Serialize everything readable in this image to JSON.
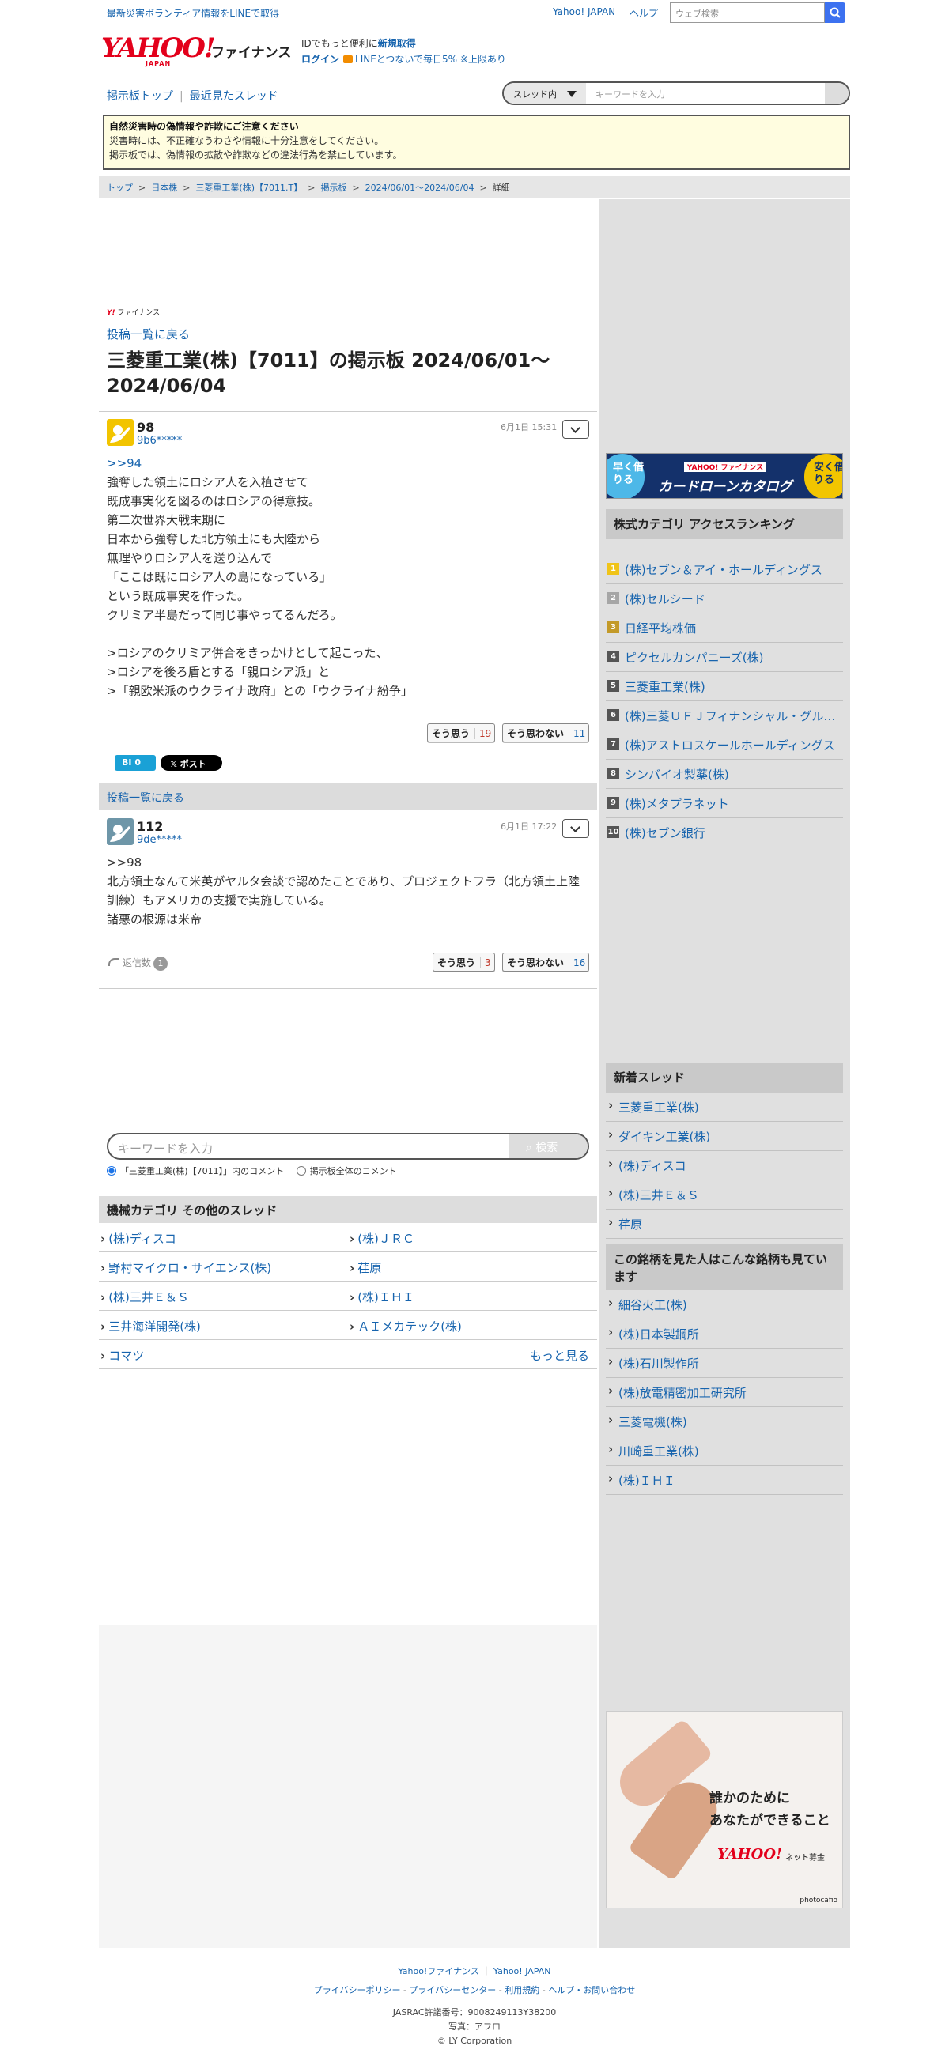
{
  "topbar": {
    "disaster_link": "最新災害ボランティア情報をLINEで取得",
    "yahoo_japan": "Yahoo! JAPAN",
    "help": "ヘルプ",
    "web_search_placeholder": "ウェブ検索"
  },
  "header": {
    "logo_text": "YAHOO!",
    "logo_sub": "JAPAN",
    "service": "ファイナンス",
    "id_prefix": "IDでもっと便利に",
    "id_register": "新規取得",
    "login": "ログイン",
    "line_promo": "LINEとつないで毎日5% ※上限あり"
  },
  "nav": {
    "board_top": "掲示板トップ",
    "recent_threads": "最近見たスレッド",
    "scope": "スレッド内",
    "search_placeholder": "キーワードを入力"
  },
  "notice": {
    "title": "自然災害時の偽情報や詐欺にご注意ください",
    "line1": "災害時には、不正確なうわさや情報に十分注意をしてください。",
    "line2": "掲示板では、偽情報の拡散や詐欺などの違法行為を禁止しています。"
  },
  "breadcrumb": [
    "トップ",
    "日本株",
    "三菱重工業(株)【7011.T】",
    "掲示板",
    "2024/06/01〜2024/06/04",
    "詳細"
  ],
  "main": {
    "small_logo": "ファイナンス",
    "back_link": "投稿一覧に戻る",
    "title": "三菱重工業(株)【7011】の掲示板 2024/06/01〜2024/06/04"
  },
  "posts": [
    {
      "num": "98",
      "user": "9b6*****",
      "date": "6月1日 15:31",
      "reply_link": ">>94",
      "lines": [
        "強奪した領土にロシア人を入植させて",
        "既成事実化を図るのはロシアの得意技。",
        "第二次世界大戦末期に",
        "日本から強奪した北方領土にも大陸から",
        "無理やりロシア人を送り込んで",
        "「ここは既にロシア人の島になっている」",
        "という既成事実を作った。",
        "クリミア半島だって同じ事やってるんだろ。",
        "",
        ">ロシアのクリミア併合をきっかけとして起こった、",
        ">ロシアを後ろ盾とする「親ロシア派」と",
        ">「親欧米派のウクライナ政府」との「ウクライナ紛争」"
      ],
      "agree_label": "そう思う",
      "agree": "19",
      "disagree_label": "そう思わない",
      "disagree": "11"
    },
    {
      "num": "112",
      "user": "9de*****",
      "date": "6月1日 17:22",
      "lines": [
        ">>98",
        "北方領土なんて米英がヤルタ会談で認めたことであり、プロジェクトフラ（北方領土上陸訓練）もアメリカの支援で実施している。",
        "諸悪の根源は米帝"
      ],
      "agree_label": "そう思う",
      "agree": "3",
      "disagree_label": "そう思わない",
      "disagree": "16",
      "reply_label": "返信数",
      "reply_count": "1"
    }
  ],
  "share": {
    "bi": "BI",
    "bi_count": "0",
    "xpost": "ポスト"
  },
  "back_bar": "投稿一覧に戻る",
  "keyword_search": {
    "placeholder": "キーワードを入力",
    "button": "検索",
    "radio_thread": "「三菱重工業(株)【7011】」内のコメント",
    "radio_all": "掲示板全体のコメント"
  },
  "category": {
    "title": "機械カテゴリ その他のスレッド",
    "items": [
      "(株)ディスコ",
      "(株)ＪＲＣ",
      "野村マイクロ・サイエンス(株)",
      "荏原",
      "(株)三井Ｅ＆Ｓ",
      "(株)ＩＨＩ",
      "三井海洋開発(株)",
      "ＡＩメカテック(株)",
      "コマツ"
    ],
    "more": "もっと見る"
  },
  "sidebar": {
    "ad_top": {
      "left": "早く借りる",
      "right": "安く借りる",
      "brand": "YAHOO! ファイナンス",
      "title": "カードローンカタログ"
    },
    "ranking_title": "株式カテゴリ アクセスランキング",
    "ranking": [
      "(株)セブン＆アイ・ホールディングス",
      "(株)セルシード",
      "日経平均株価",
      "ピクセルカンパニーズ(株)",
      "三菱重工業(株)",
      "(株)三菱ＵＦＪフィナンシャル・グループ",
      "(株)アストロスケールホールディングス",
      "シンバイオ製薬(株)",
      "(株)メタプラネット",
      "(株)セブン銀行"
    ],
    "new_threads_title": "新着スレッド",
    "new_threads": [
      "三菱重工業(株)",
      "ダイキン工業(株)",
      "(株)ディスコ",
      "(株)三井Ｅ＆Ｓ",
      "荏原"
    ],
    "also_viewed_title": "この銘柄を見た人はこんな銘柄も見ています",
    "also_viewed": [
      "細谷火工(株)",
      "(株)日本製鋼所",
      "(株)石川製作所",
      "(株)放電精密加工研究所",
      "三菱電機(株)",
      "川崎重工業(株)",
      "(株)ＩＨＩ"
    ],
    "ad_bottom": {
      "line1": "誰かのために",
      "line2": "あなたができること",
      "brand": "YAHOO!",
      "brand_sub": "ネット募金",
      "credit": "photocafio"
    }
  },
  "footer": {
    "links1": [
      "Yahoo!ファイナンス",
      "Yahoo! JAPAN"
    ],
    "links2": [
      "プライバシーポリシー",
      "プライバシーセンター",
      "利用規約",
      "ヘルプ・お問い合わせ"
    ],
    "jasrac": "JASRAC許諾番号：9008249113Y38200",
    "photo": "写真：アフロ",
    "copyright": "© LY Corporation"
  },
  "colors": {
    "link": "#1764ae",
    "brand_red": "#e3001b",
    "search_blue": "#3c71f0"
  }
}
